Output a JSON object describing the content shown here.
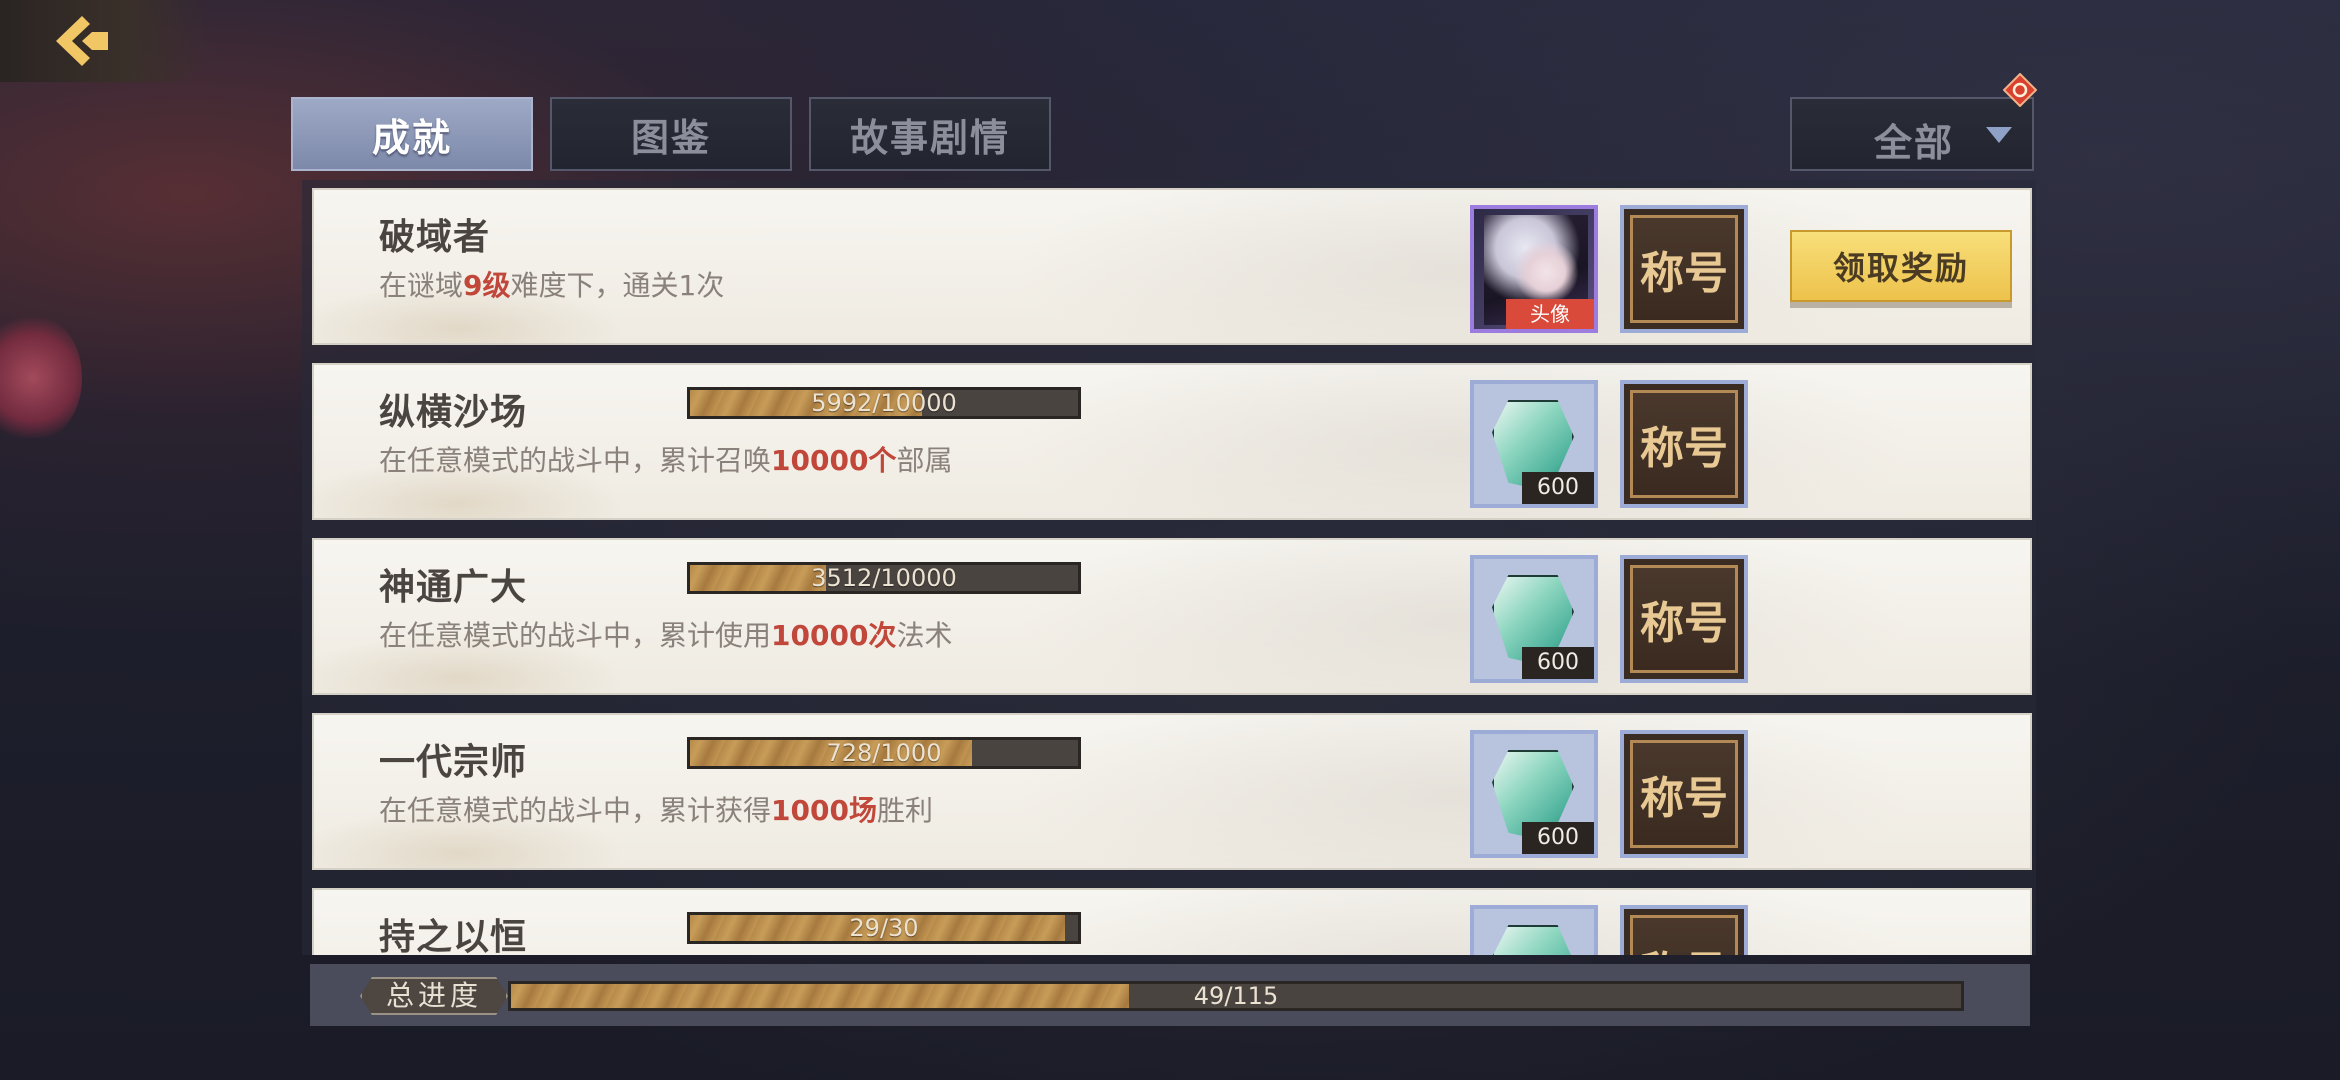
{
  "tabs": [
    {
      "label": "成就",
      "active": true
    },
    {
      "label": "图鉴",
      "active": false
    },
    {
      "label": "故事剧情",
      "active": false
    }
  ],
  "filter": {
    "label": "全部"
  },
  "achievements": [
    {
      "title": "破域者",
      "desc_parts": [
        "在谜域",
        "9级",
        "难度下，通关1次"
      ],
      "progress": null,
      "reward1": {
        "type": "portrait",
        "tag": "头像"
      },
      "reward2": {
        "label": "称号"
      },
      "claim_label": "领取奖励"
    },
    {
      "title": "纵横沙场",
      "desc_parts": [
        "在任意模式的战斗中，累计召唤",
        "10000个",
        "部属"
      ],
      "progress": {
        "current": 5992,
        "total": 10000,
        "text": "5992/10000"
      },
      "reward1": {
        "type": "gem",
        "qty": "600"
      },
      "reward2": {
        "label": "称号"
      }
    },
    {
      "title": "神通广大",
      "desc_parts": [
        "在任意模式的战斗中，累计使用",
        "10000次",
        "法术"
      ],
      "progress": {
        "current": 3512,
        "total": 10000,
        "text": "3512/10000"
      },
      "reward1": {
        "type": "gem",
        "qty": "600"
      },
      "reward2": {
        "label": "称号"
      }
    },
    {
      "title": "一代宗师",
      "desc_parts": [
        "在任意模式的战斗中，累计获得",
        "1000场",
        "胜利"
      ],
      "progress": {
        "current": 728,
        "total": 1000,
        "text": "728/1000"
      },
      "reward1": {
        "type": "gem",
        "qty": "600"
      },
      "reward2": {
        "label": "称号"
      }
    },
    {
      "title": "持之以恒",
      "desc_parts": [
        "",
        "",
        ""
      ],
      "progress": {
        "current": 29,
        "total": 30,
        "text": "29/30"
      },
      "reward1": {
        "type": "gem",
        "qty": ""
      },
      "reward2": {
        "label": "称号"
      }
    }
  ],
  "total_progress": {
    "label": "总进度",
    "current": 49,
    "total": 115,
    "text": "49/115"
  },
  "colors": {
    "highlight": "#c0473a",
    "tab_active": "#8c97b6",
    "claim_button": "#f2cd5d"
  },
  "icons": {
    "back": "back-arrow-icon",
    "notification": "red-diamond-badge-icon",
    "dropdown": "triangle-down-icon",
    "gem": "jade-gem-icon"
  }
}
